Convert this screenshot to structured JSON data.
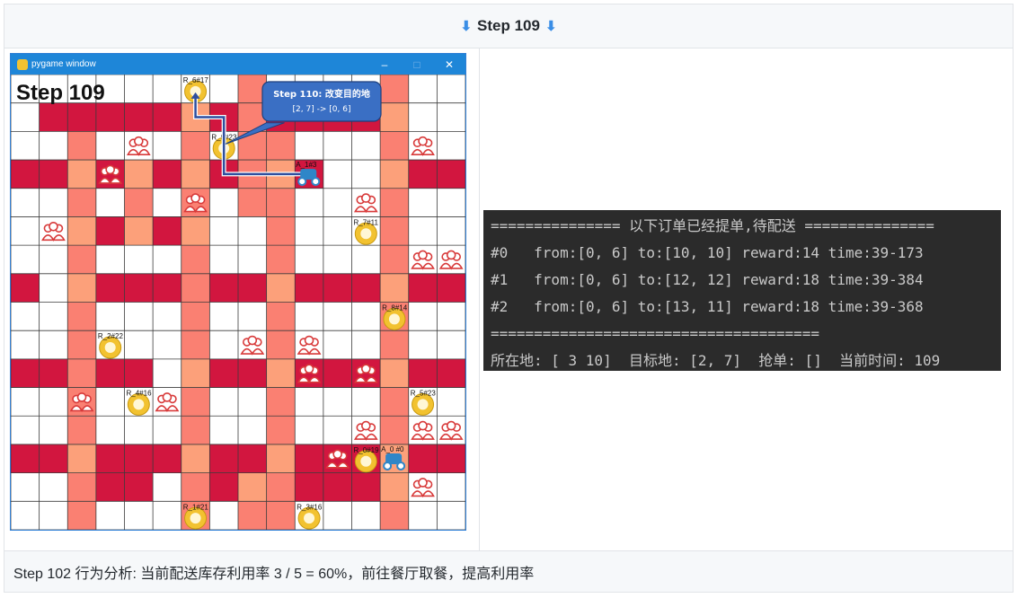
{
  "header": {
    "step_title": "Step 109",
    "arrow": "⬇"
  },
  "window": {
    "title": "pygame window",
    "minimize": "–",
    "maximize": "□",
    "close": "✕",
    "step_label": "Step 109"
  },
  "callout": {
    "line1": "Step 110: 改变目的地",
    "line2": "[2, 7] -> [0, 6]"
  },
  "grid": {
    "columns": 16,
    "rows": 16,
    "colors": {
      "red": "#d2163f",
      "salmon": "#fa8072",
      "peach": "#fca07a",
      "line": "#3b3b3b",
      "path": "#2f4f9f",
      "restaurant": "#f2c230",
      "customer": "#d83a3a"
    },
    "restaurants": [
      {
        "label": "R_6#17",
        "c": 6,
        "r": 0
      },
      {
        "label": "R_9#23",
        "c": 7,
        "r": 2
      },
      {
        "label": "R_7#11",
        "c": 12,
        "r": 5
      },
      {
        "label": "R_8#14",
        "c": 13,
        "r": 8
      },
      {
        "label": "R_2#22",
        "c": 3,
        "r": 9
      },
      {
        "label": "R_4#16",
        "c": 4,
        "r": 11
      },
      {
        "label": "R_5#23",
        "c": 14,
        "r": 11
      },
      {
        "label": "R_0#19",
        "c": 12,
        "r": 13
      },
      {
        "label": "R_1#21",
        "c": 6,
        "r": 15
      },
      {
        "label": "R_3#16",
        "c": 10,
        "r": 15
      }
    ],
    "agents": [
      {
        "label": "A_1#3",
        "c": 10,
        "r": 3
      },
      {
        "label": "A_0 #0",
        "c": 13,
        "r": 13
      }
    ]
  },
  "terminal": {
    "lines": [
      "=============== 以下订单已经提单,待配送 ===============",
      "#0   from:[0, 6] to:[10, 10] reward:14 time:39-173",
      "#1   from:[0, 6] to:[12, 12] reward:18 time:39-384",
      "#2   from:[0, 6] to:[13, 11] reward:18 time:39-368",
      "======================================",
      "所在地: [ 3 10]  目标地: [2, 7]  抢单: []  当前时间: 109"
    ]
  },
  "footer": {
    "text": "Step 102 行为分析:  当前配送库存利用率 3 / 5 = 60%，前往餐厅取餐，提高利用率"
  }
}
